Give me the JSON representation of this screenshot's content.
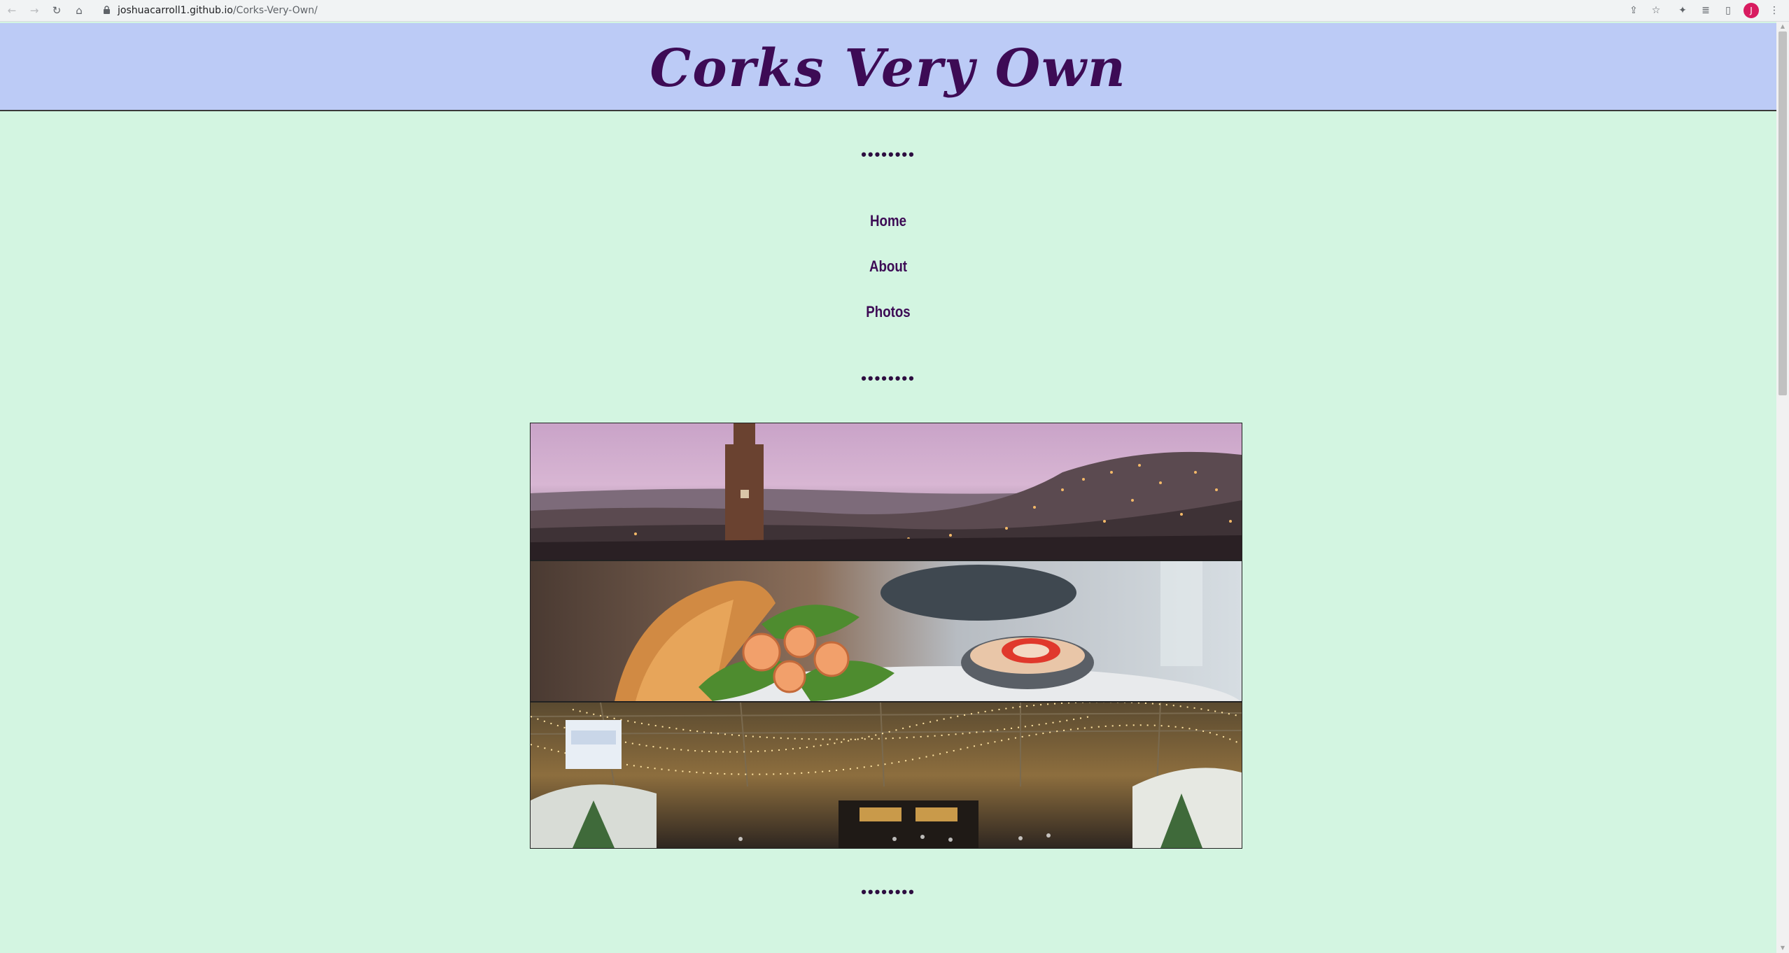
{
  "browser": {
    "url_host": "joshuacarroll1.github.io",
    "url_path": "/Corks-Very-Own/",
    "profile_initial": "J",
    "icons": [
      "back-icon",
      "forward-icon",
      "reload-icon",
      "home-icon",
      "lock-icon",
      "share-icon",
      "star-icon",
      "extensions-icon",
      "reading-list-icon",
      "side-panel-icon",
      "menu-icon"
    ]
  },
  "header": {
    "title": "Corks Very Own",
    "background": "#bccbf6",
    "title_color": "#3d0b55"
  },
  "divider": "••••••••",
  "nav": {
    "items": [
      {
        "label": "Home"
      },
      {
        "label": "About"
      },
      {
        "label": "Photos"
      }
    ]
  },
  "gallery": {
    "images": [
      {
        "name": "cork-city-skyline-image",
        "alt": "Cork city skyline at dusk with church tower"
      },
      {
        "name": "prawn-sandwich-image",
        "alt": "Prawn sandwich with dipping sauce"
      },
      {
        "name": "indoor-market-image",
        "alt": "Indoor market with string lights"
      }
    ]
  },
  "colors": {
    "page_background": "#d3f5e1",
    "text_accent": "#3d0b55"
  }
}
